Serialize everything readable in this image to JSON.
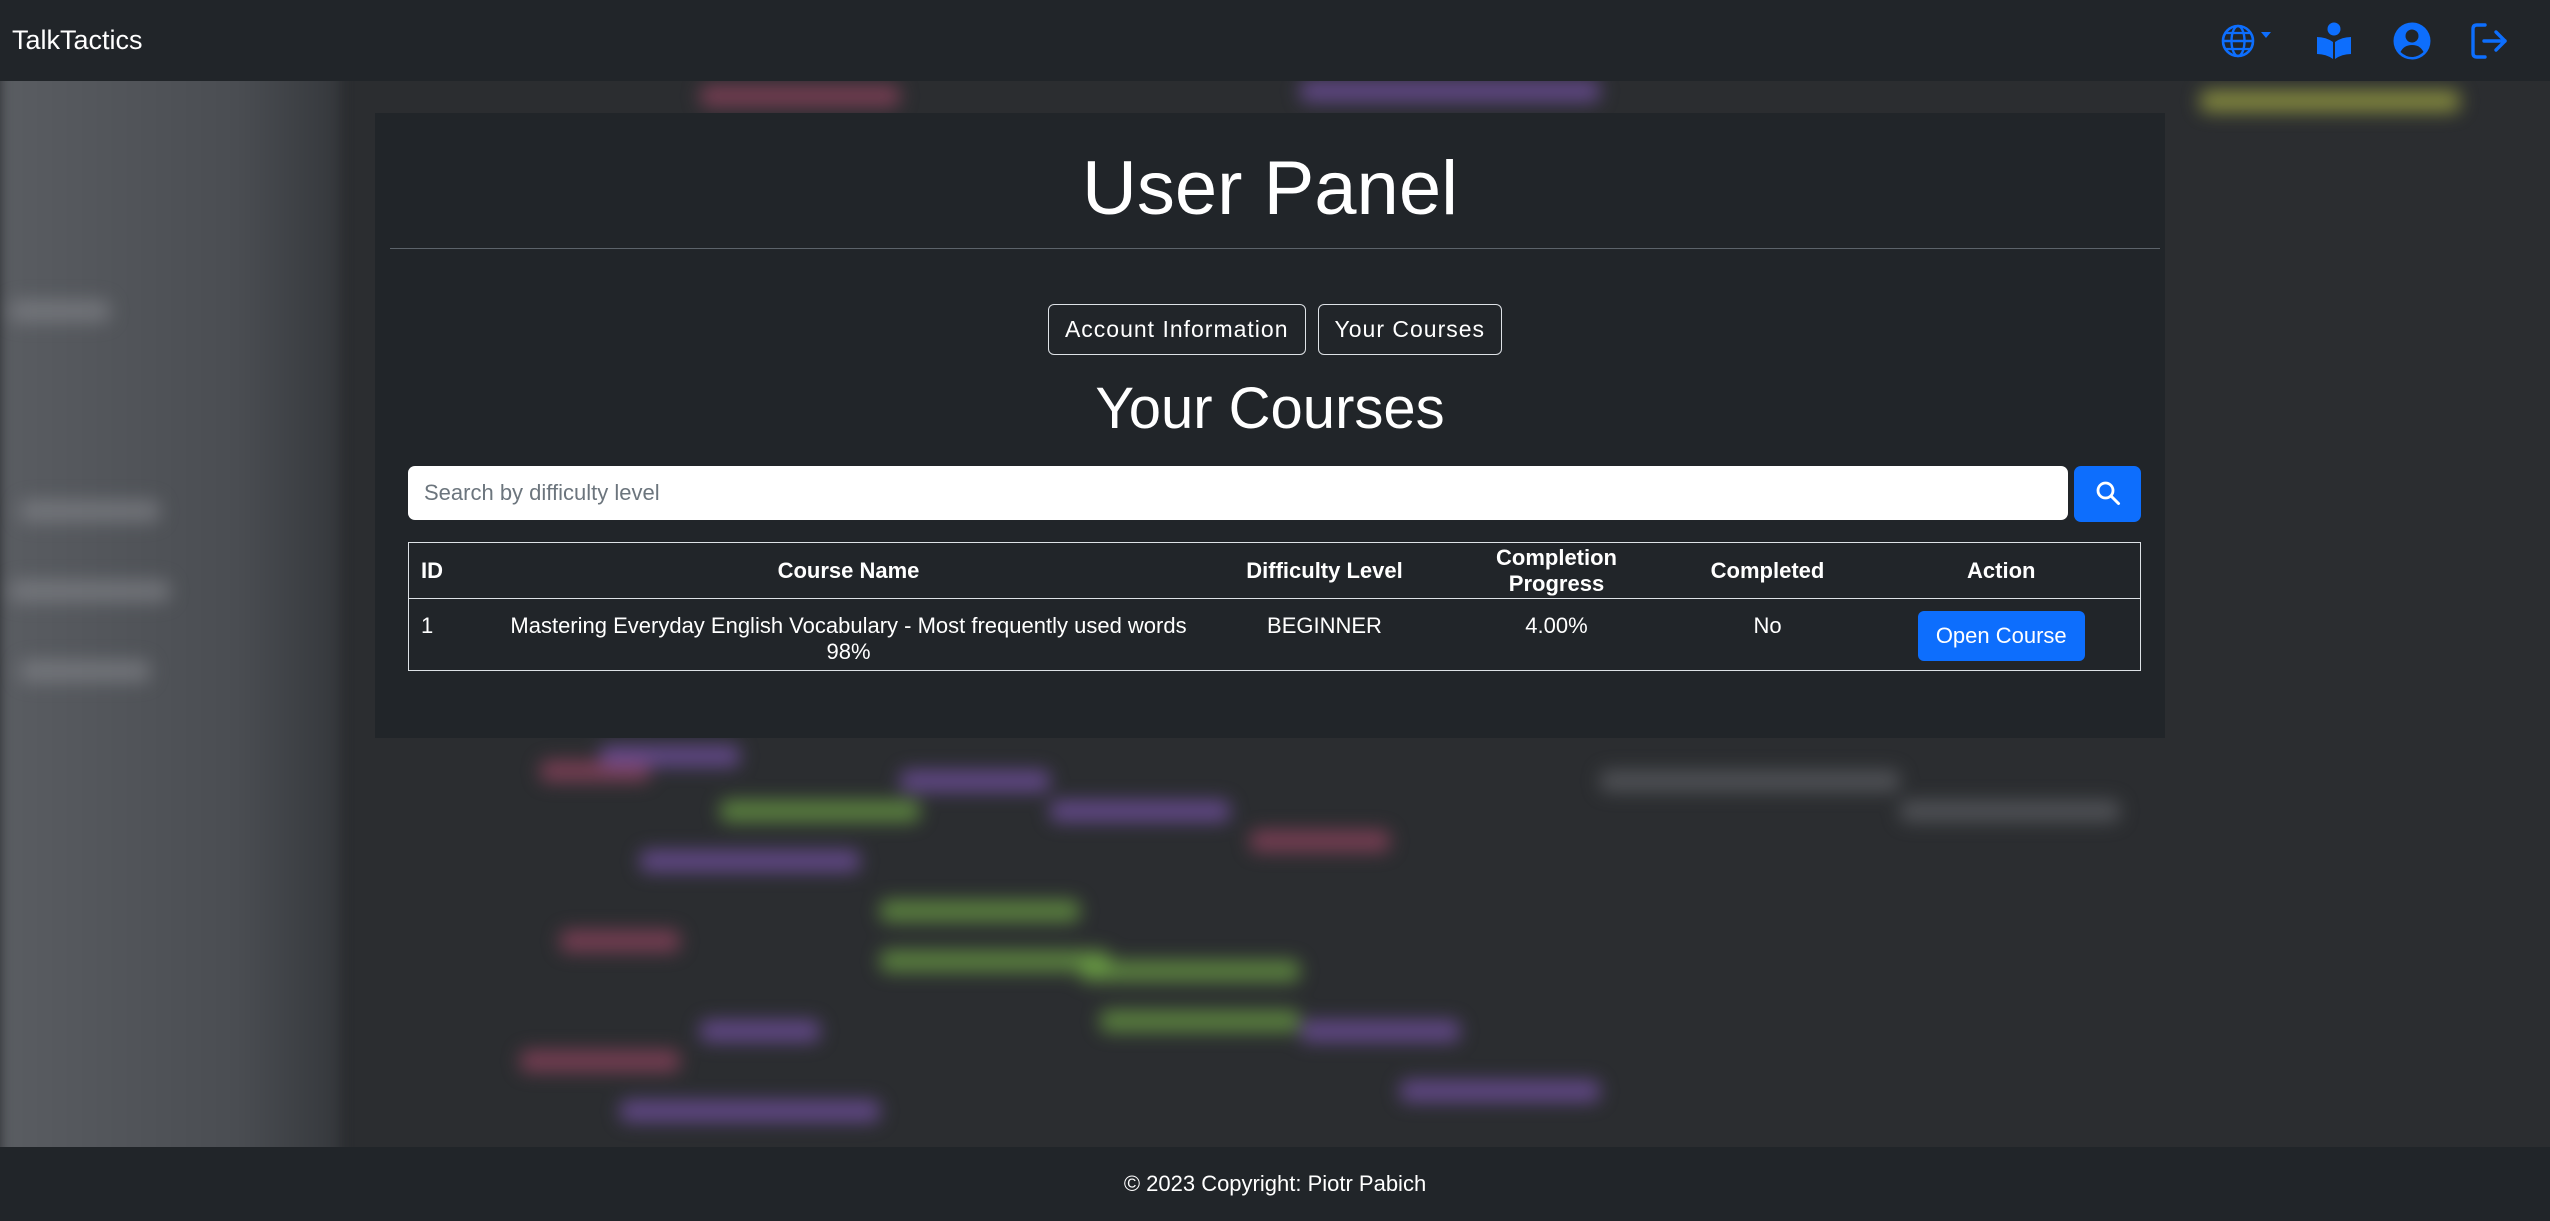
{
  "navbar": {
    "brand": "TalkTactics",
    "icons": [
      "globe-icon",
      "book-reader-icon",
      "user-circle-icon",
      "sign-out-icon"
    ],
    "accent_color": "#0d6efd"
  },
  "panel": {
    "title": "User Panel",
    "tabs": [
      {
        "label": "Account Information"
      },
      {
        "label": "Your Courses"
      }
    ],
    "section_title": "Your Courses",
    "search": {
      "placeholder": "Search by difficulty level",
      "value": "",
      "button_icon": "search-icon"
    }
  },
  "table": {
    "headers": [
      "ID",
      "Course Name",
      "Difficulty Level",
      "Completion Progress",
      "Completed",
      "Action"
    ],
    "rows": [
      {
        "id": "1",
        "course_name": "Mastering Everyday English Vocabulary - Most frequently used words 98%",
        "difficulty": "BEGINNER",
        "progress": "4.00%",
        "completed": "No",
        "action": "Open Course"
      }
    ]
  },
  "footer": {
    "text": "© 2023 Copyright: Piotr Pabich"
  }
}
